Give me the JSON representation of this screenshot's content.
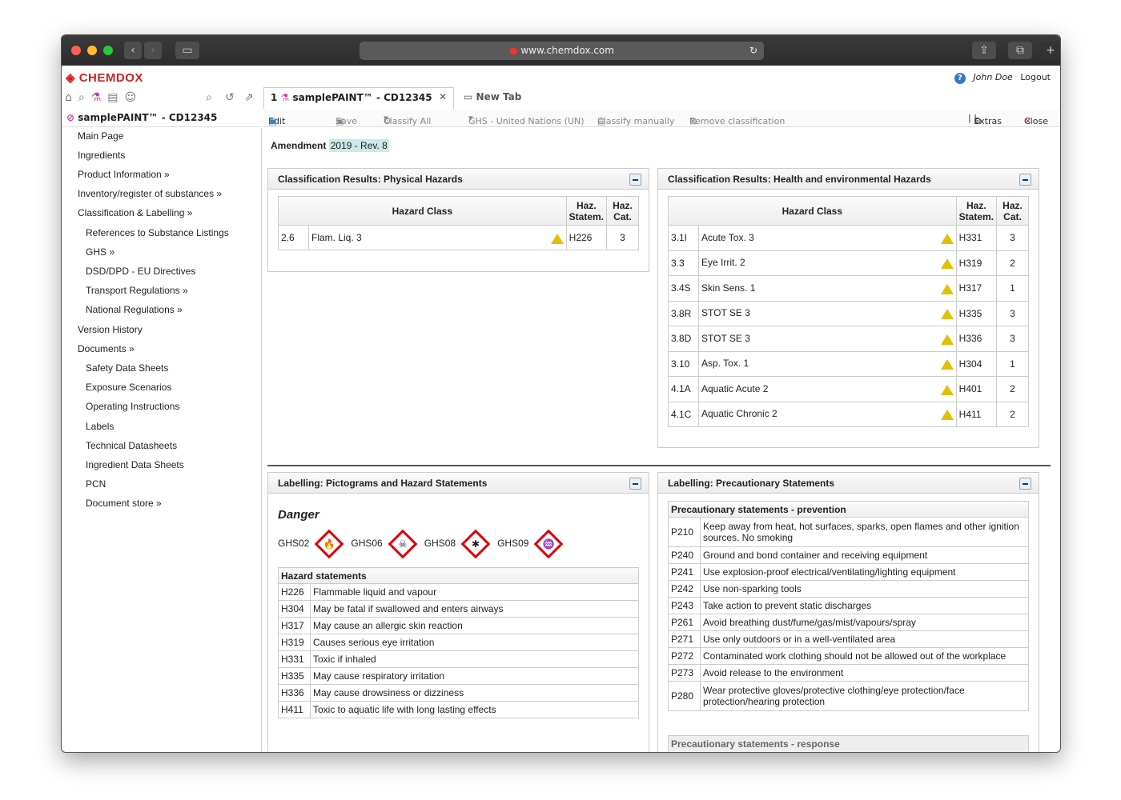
{
  "browser": {
    "url": "www.chemdox.com"
  },
  "app": {
    "logo": "CHEMDOX",
    "user": "John Doe",
    "logout": "Logout"
  },
  "tabs": [
    {
      "label": "samplePAINT™ - CD12345",
      "num": "1"
    },
    {
      "label": "New Tab"
    }
  ],
  "product": "samplePAINT™ - CD12345",
  "cmd": {
    "edit": "Edit",
    "save": "Save",
    "classify_all": "Classify All",
    "regime": "GHS - United Nations (UN)",
    "classify_manually": "Classify manually",
    "remove": "Remove classification",
    "extras": "Extras",
    "close": "Close"
  },
  "nav": [
    "Main Page",
    "Ingredients",
    "Product Information »",
    "Inventory/register of substances »",
    "Classification & Labelling »",
    "References to Substance Listings",
    "GHS »",
    "DSD/DPD - EU Directives",
    "Transport Regulations »",
    "National Regulations »",
    "Version History",
    "Documents »",
    "Safety Data Sheets",
    "Exposure Scenarios",
    "Operating Instructions",
    "Labels",
    "Technical Datasheets",
    "Ingredient Data Sheets",
    "PCN",
    "Document store »"
  ],
  "amendment": {
    "label": "Amendment",
    "value": "2019 - Rev. 8"
  },
  "physical": {
    "title": "Classification Results: Physical Hazards",
    "headers": [
      "Hazard Class",
      "Haz. Statem.",
      "Haz. Cat."
    ],
    "rows": [
      [
        "2.6",
        "Flam. Liq. 3",
        "H226",
        "3"
      ]
    ]
  },
  "health": {
    "title": "Classification Results: Health and environmental Hazards",
    "headers": [
      "Hazard Class",
      "Haz. Statem.",
      "Haz. Cat."
    ],
    "rows": [
      [
        "3.1I",
        "Acute Tox. 3",
        "H331",
        "3"
      ],
      [
        "3.3",
        "Eye Irrit. 2",
        "H319",
        "2"
      ],
      [
        "3.4S",
        "Skin Sens. 1",
        "H317",
        "1"
      ],
      [
        "3.8R",
        "STOT SE 3",
        "H335",
        "3"
      ],
      [
        "3.8D",
        "STOT SE 3",
        "H336",
        "3"
      ],
      [
        "3.10",
        "Asp. Tox. 1",
        "H304",
        "1"
      ],
      [
        "4.1A",
        "Aquatic Acute 2",
        "H401",
        "2"
      ],
      [
        "4.1C",
        "Aquatic Chronic 2",
        "H411",
        "2"
      ]
    ]
  },
  "labelling": {
    "title": "Labelling: Pictograms and Hazard Statements",
    "signal": "Danger",
    "pictograms": [
      "GHS02",
      "GHS06",
      "GHS08",
      "GHS09"
    ],
    "hs_title": "Hazard statements",
    "statements": [
      [
        "H226",
        "Flammable liquid and vapour"
      ],
      [
        "H304",
        "May be fatal if swallowed and enters airways"
      ],
      [
        "H317",
        "May cause an allergic skin reaction"
      ],
      [
        "H319",
        "Causes serious eye irritation"
      ],
      [
        "H331",
        "Toxic if inhaled"
      ],
      [
        "H335",
        "May cause respiratory irritation"
      ],
      [
        "H336",
        "May cause drowsiness or dizziness"
      ],
      [
        "H411",
        "Toxic to aquatic life with long lasting effects"
      ]
    ]
  },
  "precaution": {
    "title": "Labelling: Precautionary Statements",
    "prev_title": "Precautionary statements - prevention",
    "resp_title": "Precautionary statements - response",
    "statements": [
      [
        "P210",
        "Keep away from heat, hot surfaces, sparks, open flames and other ignition sources. No smoking"
      ],
      [
        "P240",
        "Ground and bond container and receiving equipment"
      ],
      [
        "P241",
        "Use explosion-proof electrical/ventilating/lighting equipment"
      ],
      [
        "P242",
        "Use non-sparking tools"
      ],
      [
        "P243",
        "Take action to prevent static discharges"
      ],
      [
        "P261",
        "Avoid breathing dust/fume/gas/mist/vapours/spray"
      ],
      [
        "P271",
        "Use only outdoors or in a well-ventilated area"
      ],
      [
        "P272",
        "Contaminated work clothing should not be allowed out of the workplace"
      ],
      [
        "P273",
        "Avoid release to the environment"
      ],
      [
        "P280",
        "Wear protective gloves/protective clothing/eye protection/face protection/hearing protection"
      ]
    ]
  }
}
